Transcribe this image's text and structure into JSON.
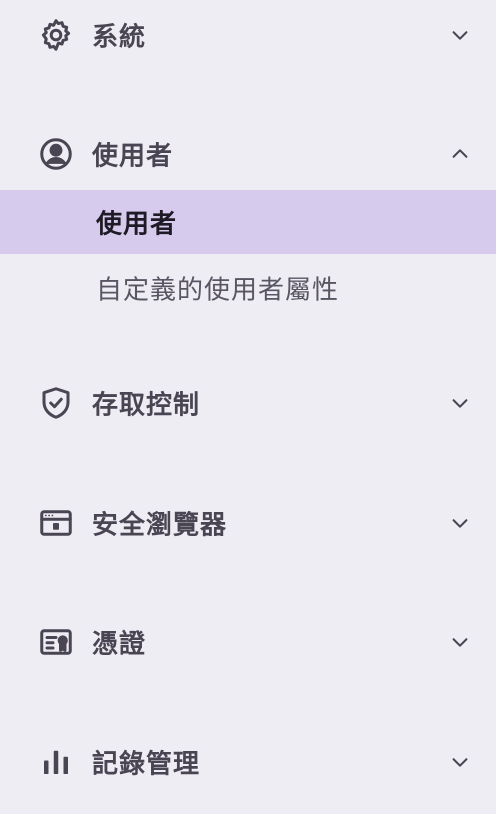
{
  "nav": {
    "sections": [
      {
        "label": "系統",
        "icon": "gear-icon",
        "expanded": false
      },
      {
        "label": "使用者",
        "icon": "user-circle-icon",
        "expanded": true,
        "sub_items": [
          {
            "label": "使用者",
            "active": true
          },
          {
            "label": "自定義的使用者屬性",
            "active": false
          }
        ]
      },
      {
        "label": "存取控制",
        "icon": "shield-check-icon",
        "expanded": false
      },
      {
        "label": "安全瀏覽器",
        "icon": "browser-window-icon",
        "expanded": false
      },
      {
        "label": "憑證",
        "icon": "certificate-icon",
        "expanded": false
      },
      {
        "label": "記錄管理",
        "icon": "bar-chart-icon",
        "expanded": false
      }
    ]
  },
  "colors": {
    "background": "#efedf4",
    "active_item_bg": "#d6cbed",
    "text": "#4a4553",
    "active_text": "#1f1b26"
  }
}
